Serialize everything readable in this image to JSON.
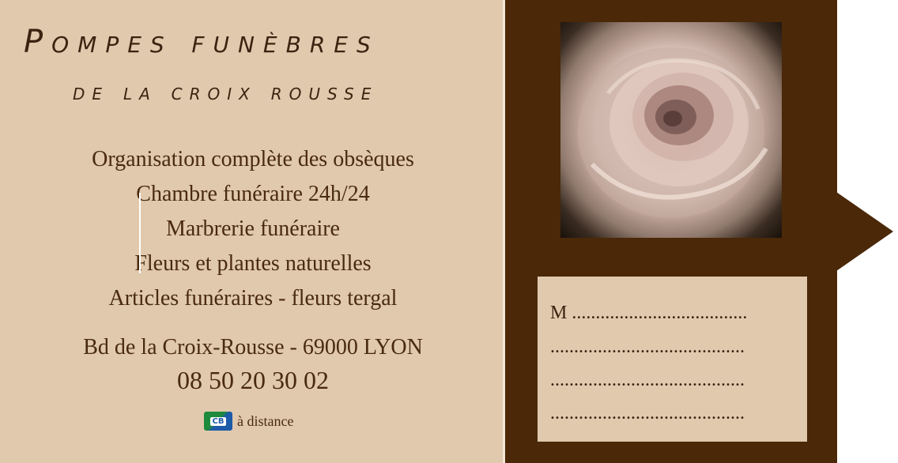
{
  "header": {
    "title": "Pompes funèbres",
    "subtitle": "de la croix rousse"
  },
  "services": [
    "Organisation complète des obsèques",
    "Chambre funéraire 24h/24",
    "Marbrerie funéraire",
    "Fleurs et plantes naturelles",
    "Articles funéraires - fleurs tergal"
  ],
  "contact": {
    "address": "Bd de la Croix-Rousse - 69000 LYON",
    "phone": "08 50 20 30 02"
  },
  "payment": {
    "logo_text": "CB",
    "label": "à distance"
  },
  "note": {
    "lines": [
      "M .....................................",
      ".........................................",
      ".........................................",
      "........................................."
    ]
  },
  "colors": {
    "beige": "#e0c9ad",
    "brown": "#4a2808",
    "text": "#4a2a10"
  },
  "icons": {
    "photo": "rose-photo",
    "payment": "cb-card-icon"
  }
}
